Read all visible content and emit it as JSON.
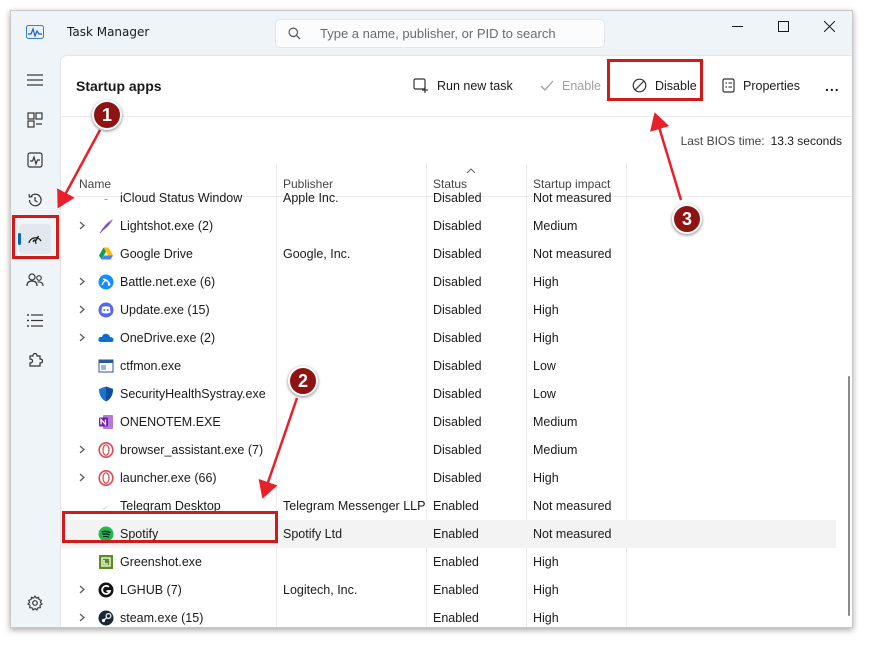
{
  "window": {
    "title": "Task Manager"
  },
  "search": {
    "placeholder": "Type a name, publisher, or PID to search"
  },
  "page": {
    "title": "Startup apps"
  },
  "toolbar": {
    "run_new_task": "Run new task",
    "enable": "Enable",
    "disable": "Disable",
    "properties": "Properties",
    "more": "..."
  },
  "bios": {
    "label": "Last BIOS time:",
    "value": "13.3 seconds"
  },
  "columns": {
    "name": "Name",
    "publisher": "Publisher",
    "status": "Status",
    "impact": "Startup impact"
  },
  "rows": [
    {
      "name": "iCloud Status Window",
      "publisher": "Apple Inc.",
      "status": "Disabled",
      "impact": "Not measured",
      "expandable": false,
      "icon": "icloud-icon"
    },
    {
      "name": "Lightshot.exe (2)",
      "publisher": "",
      "status": "Disabled",
      "impact": "Medium",
      "expandable": true,
      "icon": "feather-icon"
    },
    {
      "name": "Google Drive",
      "publisher": "Google, Inc.",
      "status": "Disabled",
      "impact": "Not measured",
      "expandable": false,
      "icon": "google-drive-icon"
    },
    {
      "name": "Battle.net.exe (6)",
      "publisher": "",
      "status": "Disabled",
      "impact": "High",
      "expandable": true,
      "icon": "battlenet-icon"
    },
    {
      "name": "Update.exe (15)",
      "publisher": "",
      "status": "Disabled",
      "impact": "High",
      "expandable": true,
      "icon": "discord-icon"
    },
    {
      "name": "OneDrive.exe (2)",
      "publisher": "",
      "status": "Disabled",
      "impact": "High",
      "expandable": true,
      "icon": "onedrive-icon"
    },
    {
      "name": "ctfmon.exe",
      "publisher": "",
      "status": "Disabled",
      "impact": "Low",
      "expandable": false,
      "icon": "ctfmon-icon"
    },
    {
      "name": "SecurityHealthSystray.exe",
      "publisher": "",
      "status": "Disabled",
      "impact": "Low",
      "expandable": false,
      "icon": "shield-icon"
    },
    {
      "name": "ONENOTEM.EXE",
      "publisher": "",
      "status": "Disabled",
      "impact": "Medium",
      "expandable": false,
      "icon": "onenote-icon"
    },
    {
      "name": "browser_assistant.exe (7)",
      "publisher": "",
      "status": "Disabled",
      "impact": "Medium",
      "expandable": true,
      "icon": "opera-icon"
    },
    {
      "name": "launcher.exe (66)",
      "publisher": "",
      "status": "Disabled",
      "impact": "High",
      "expandable": true,
      "icon": "opera-icon"
    },
    {
      "name": "Telegram Desktop",
      "publisher": "Telegram Messenger LLP",
      "status": "Enabled",
      "impact": "Not measured",
      "expandable": false,
      "icon": "telegram-icon"
    },
    {
      "name": "Spotify",
      "publisher": "Spotify Ltd",
      "status": "Enabled",
      "impact": "Not measured",
      "expandable": false,
      "icon": "spotify-icon"
    },
    {
      "name": "Greenshot.exe",
      "publisher": "",
      "status": "Enabled",
      "impact": "High",
      "expandable": false,
      "icon": "greenshot-icon"
    },
    {
      "name": "LGHUB (7)",
      "publisher": "Logitech, Inc.",
      "status": "Enabled",
      "impact": "High",
      "expandable": true,
      "icon": "logitech-icon"
    },
    {
      "name": "steam.exe (15)",
      "publisher": "",
      "status": "Enabled",
      "impact": "High",
      "expandable": true,
      "icon": "steam-icon"
    }
  ],
  "annotations": {
    "step1": "1",
    "step2": "2",
    "step3": "3"
  },
  "colors": {
    "accent": "#0067c0",
    "annotation_red": "#d11b1b",
    "badge": "#8e1414"
  }
}
